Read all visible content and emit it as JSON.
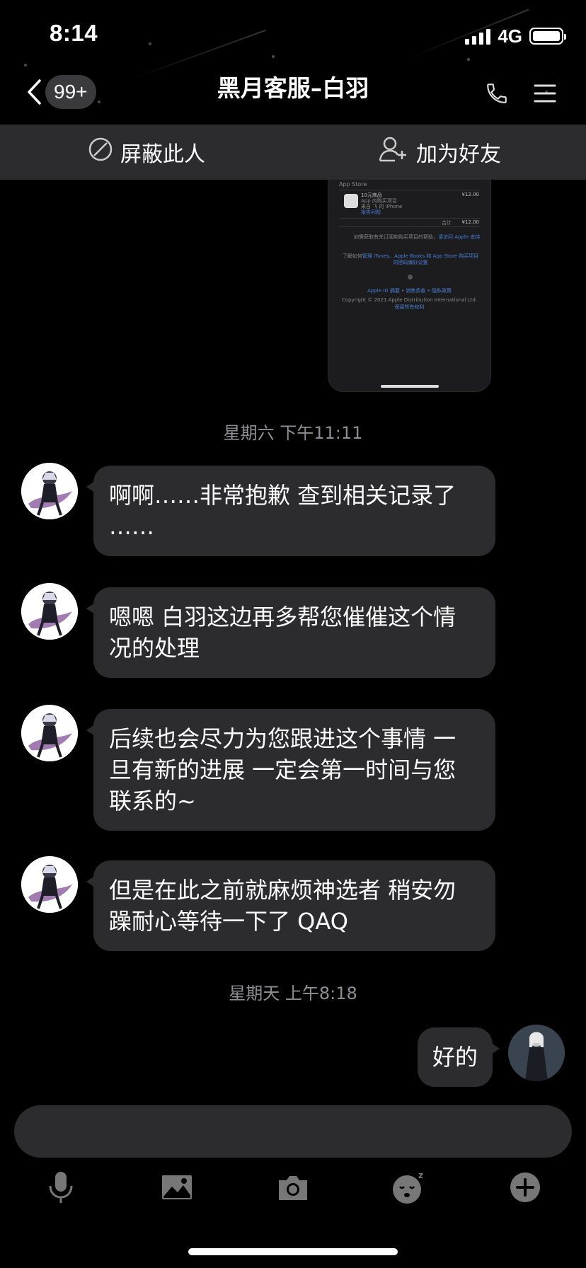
{
  "status_bar": {
    "time": "8:14",
    "network": "4G"
  },
  "nav": {
    "unread_badge": "99+",
    "title": "黑月客服–白羽"
  },
  "actions": {
    "block_label": "屏蔽此人",
    "add_friend_label": "加为好友"
  },
  "image_message": {
    "header": "App Store",
    "item_name": "10元商品",
    "item_sub": "App 内购买项目",
    "item_device": "来自 飞 的 iPhone",
    "item_link": "报告问题",
    "item_price": "¥12.00",
    "total_label": "合计",
    "total_price": "¥12.00",
    "help_text": "如需获取有关订阅和购买项目的帮助，",
    "help_link": "请访问 Apple 支持",
    "manage_text": "了解如何",
    "manage_link": "管理 iTunes、Apple Books 和 App Store 购买项目的密码偏好设置",
    "footer_links": "Apple ID 摘要 • 销售条款 • 隐私政策",
    "copyright": "Copyright © 2021 Apple Distribution International Ltd.",
    "rights_link": "保留所有权利"
  },
  "timestamps": [
    "星期六 下午11:11",
    "星期天 上午8:18"
  ],
  "messages": [
    {
      "from": "agent",
      "lines": [
        "啊啊……非常抱歉  查到相关记录了",
        "……"
      ]
    },
    {
      "from": "agent",
      "lines": [
        "嗯嗯 白羽这边再多帮您催催这个情",
        "况的处理"
      ]
    },
    {
      "from": "agent",
      "lines": [
        "后续也会尽力为您跟进这个事情 一",
        "旦有新的进展 一定会第一时间与您",
        "联系的~"
      ]
    },
    {
      "from": "agent",
      "lines": [
        "但是在此之前就麻烦神选者 稍安勿",
        "躁耐心等待一下了 QAQ"
      ]
    },
    {
      "from": "me",
      "lines": [
        "好的"
      ]
    }
  ],
  "input": {
    "value": "",
    "placeholder": ""
  },
  "toolbar": {
    "icons": [
      "microphone-icon",
      "image-icon",
      "camera-icon",
      "emoji-icon",
      "plus-icon"
    ]
  },
  "colors": {
    "background": "#000000",
    "bubble": "#2c2c2e",
    "action_bar": "#2c2c2e",
    "timestamp": "#8e8e93"
  }
}
